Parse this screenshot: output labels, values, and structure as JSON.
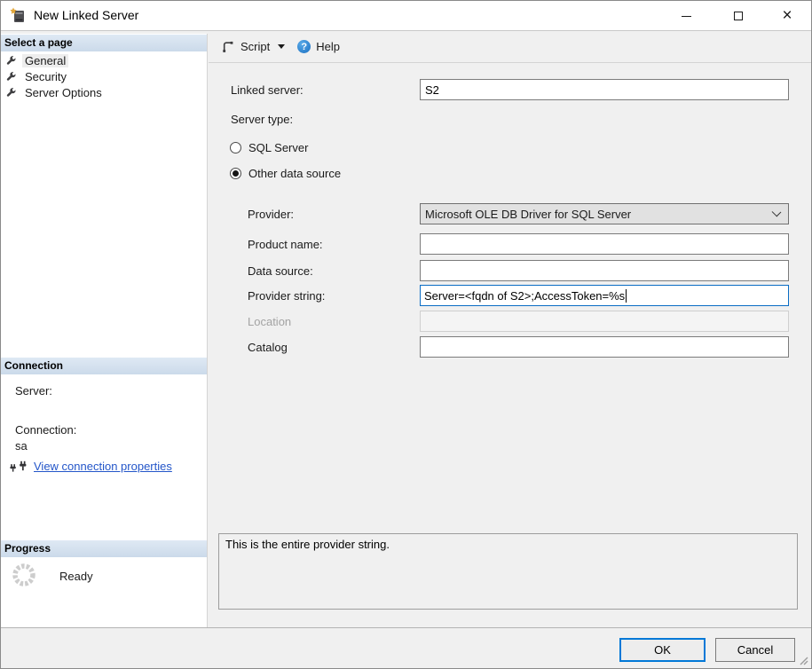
{
  "window": {
    "title": "New Linked Server",
    "controls": {
      "minimize": "minimize",
      "maximize": "maximize",
      "close": "×"
    }
  },
  "toolbar": {
    "script_label": "Script",
    "help_label": "Help",
    "help_glyph": "?"
  },
  "sidebar": {
    "select_page": {
      "header": "Select a page",
      "items": [
        {
          "label": "General",
          "selected": true
        },
        {
          "label": "Security",
          "selected": false
        },
        {
          "label": "Server Options",
          "selected": false
        }
      ]
    },
    "connection": {
      "header": "Connection",
      "server_label": "Server:",
      "connection_label": "Connection:",
      "connection_value": "sa",
      "link_label": "View connection properties"
    },
    "progress": {
      "header": "Progress",
      "status": "Ready"
    }
  },
  "form": {
    "linked_server": {
      "label": "Linked server:",
      "value": "S2"
    },
    "server_type": {
      "label": "Server type:",
      "options": [
        {
          "label": "SQL Server",
          "selected": false
        },
        {
          "label": "Other data source",
          "selected": true
        }
      ]
    },
    "provider": {
      "label": "Provider:",
      "value": "Microsoft OLE DB Driver for SQL Server"
    },
    "product_name": {
      "label": "Product name:",
      "value": ""
    },
    "data_source": {
      "label": "Data source:",
      "value": ""
    },
    "provider_string": {
      "label": "Provider string:",
      "value": "Server=<fqdn of S2>;AccessToken=%s"
    },
    "location": {
      "label": "Location",
      "value": "",
      "disabled": true
    },
    "catalog": {
      "label": "Catalog",
      "value": ""
    },
    "description": "This is the entire provider string."
  },
  "footer": {
    "ok_label": "OK",
    "cancel_label": "Cancel"
  },
  "colors": {
    "accent": "#0078d7",
    "section_header_top": "#dfe9f4",
    "section_header_bottom": "#cbdaea",
    "link": "#2456c9",
    "panel_bg": "#f0f0f0"
  },
  "icons": {
    "titlebar": "new-linked-server-icon",
    "pages": "wrench-icon",
    "script": "script-icon",
    "help": "help-icon",
    "connection_link": "plug-icon",
    "progress": "spinner-icon"
  }
}
